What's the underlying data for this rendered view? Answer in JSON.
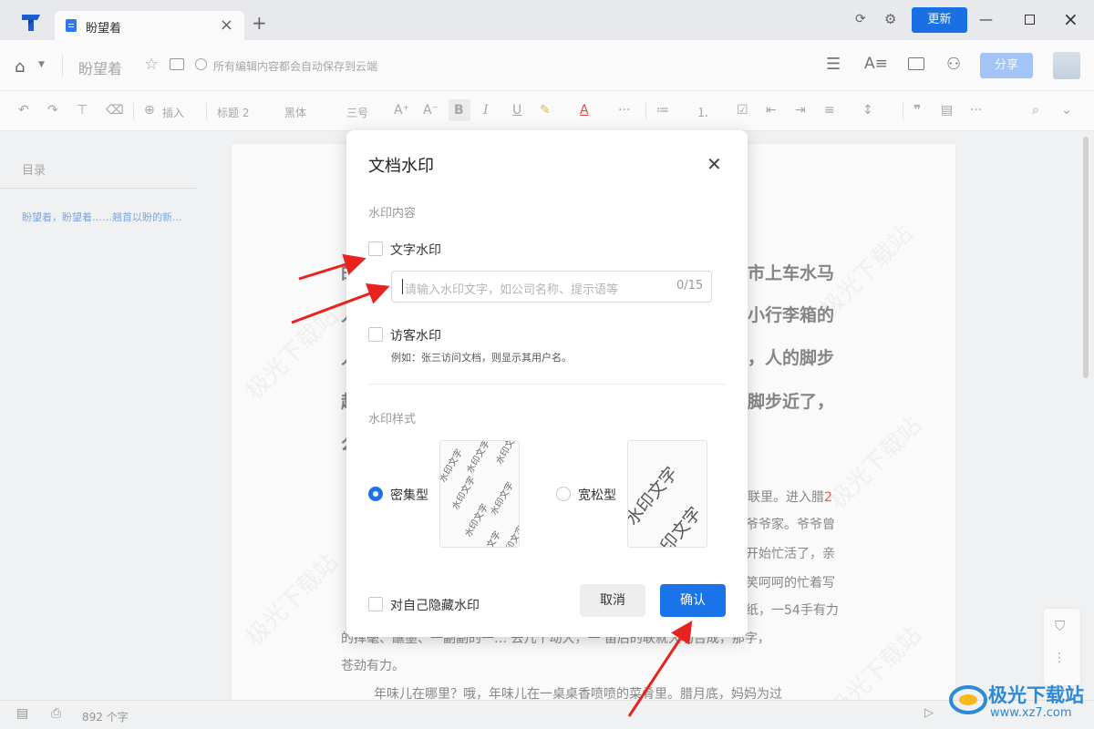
{
  "titlebar": {
    "tab_title": "盼望着",
    "update_label": "更新"
  },
  "header": {
    "doc_title": "盼望着",
    "save_status": "所有编辑内容都会自动保存到云端",
    "share_label": "分享"
  },
  "toolbar": {
    "insert_label": "插入",
    "heading_label": "标题 2",
    "font_label": "黑体",
    "size_label": "三号"
  },
  "outline": {
    "title": "目录",
    "item": "盼望着，盼望着……翘首以盼的新..."
  },
  "document": {
    "big_lines": [
      "市上车水马",
      "小行李箱的",
      "，人的脚步",
      "脚步近了，"
    ],
    "body_lines": [
      "联里。进入腊",
      "爷爷家。爷爷曾",
      "开始忙活了，亲",
      "笑呵呵的忙着写",
      "纸，一54手有力",
      "的挥毫、蘸墨、一副副的一…    去几个动大，一 笛后的联就大功告成，那字，",
      "苍劲有力。",
      "年味儿在哪里？哦，年味儿在一桌桌香喷喷的菜肴里。腊月底，妈妈为过"
    ],
    "red_text_1": "2",
    "watermark_text": "极光下载站"
  },
  "statusbar": {
    "word_count": "892 个字"
  },
  "dialog": {
    "title": "文档水印",
    "content_section": "水印内容",
    "text_watermark_label": "文字水印",
    "text_input_placeholder": "请输入水印文字，如公司名称、提示语等",
    "text_input_counter": "0/15",
    "visitor_watermark_label": "访客水印",
    "visitor_watermark_hint": "例如：张三访问文档，则显示其用户名。",
    "style_section": "水印样式",
    "style_dense_label": "密集型",
    "style_loose_label": "宽松型",
    "preview_sample": "水印文字",
    "hide_for_self_label": "对自己隐藏水印",
    "cancel_label": "取消",
    "confirm_label": "确认",
    "selected_style": "密集型"
  },
  "site_logo": {
    "name": "极光下载站",
    "url": "www.xz7.com"
  },
  "colors": {
    "accent": "#1a73e8",
    "share_disabled": "#a6c8fb",
    "annotation_arrow": "#e8221f"
  }
}
